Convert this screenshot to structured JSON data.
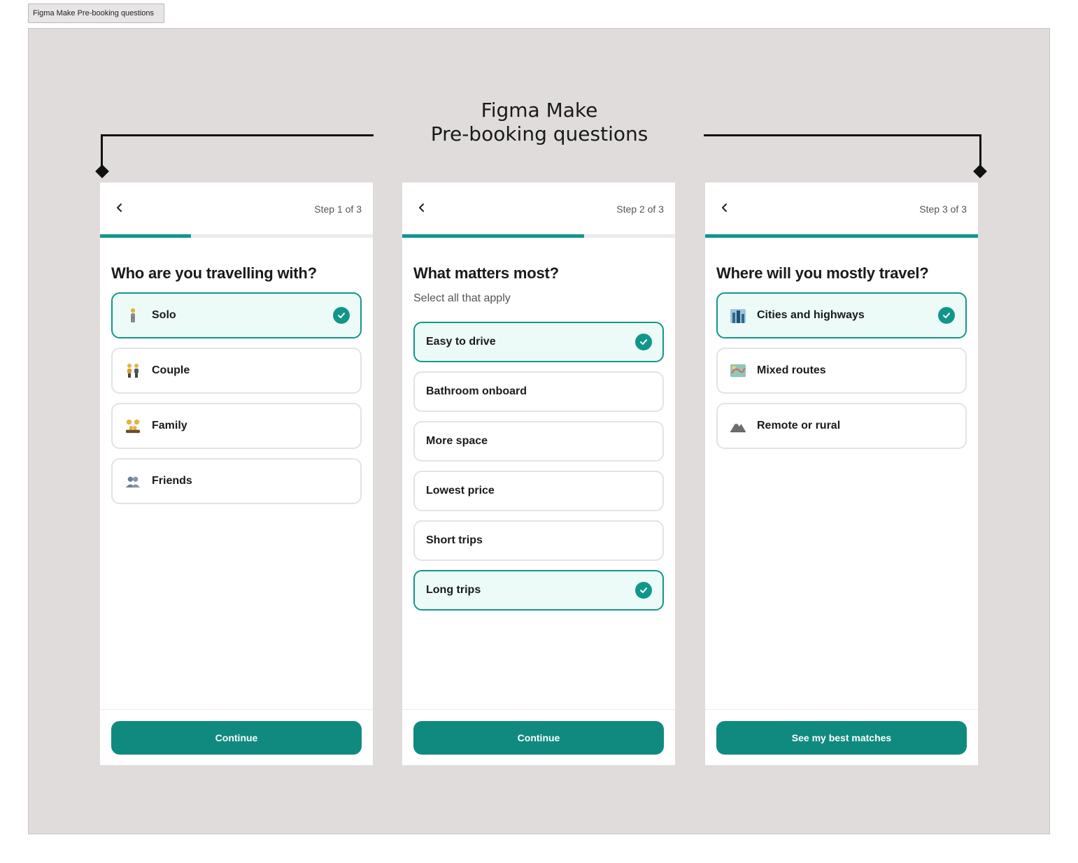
{
  "frame_tag": "Figma Make Pre-booking questions",
  "section_title": "Figma Make\nPre-booking questions",
  "accent_color": "#12968a",
  "screens": [
    {
      "step": "Step 1 of 3",
      "progress": 0.333,
      "question": "Who are you travelling with?",
      "subtitle": "",
      "options": [
        {
          "label": "Solo",
          "icon": "person-icon",
          "selected": true
        },
        {
          "label": "Couple",
          "icon": "couple-icon",
          "selected": false
        },
        {
          "label": "Family",
          "icon": "family-icon",
          "selected": false
        },
        {
          "label": "Friends",
          "icon": "friends-icon",
          "selected": false
        }
      ],
      "cta": "Continue"
    },
    {
      "step": "Step 2 of 3",
      "progress": 0.667,
      "question": "What matters most?",
      "subtitle": "Select all that apply",
      "options": [
        {
          "label": "Easy to drive",
          "selected": true
        },
        {
          "label": "Bathroom onboard",
          "selected": false
        },
        {
          "label": "More space",
          "selected": false
        },
        {
          "label": "Lowest price",
          "selected": false
        },
        {
          "label": "Short trips",
          "selected": false
        },
        {
          "label": "Long trips",
          "selected": true
        }
      ],
      "cta": "Continue"
    },
    {
      "step": "Step 3 of 3",
      "progress": 1.0,
      "question": "Where will you mostly travel?",
      "subtitle": "",
      "options": [
        {
          "label": "Cities and highways",
          "icon": "city-icon",
          "selected": true
        },
        {
          "label": "Mixed routes",
          "icon": "map-icon",
          "selected": false
        },
        {
          "label": "Remote or rural",
          "icon": "mountain-icon",
          "selected": false
        }
      ],
      "cta": "See my best matches"
    }
  ]
}
